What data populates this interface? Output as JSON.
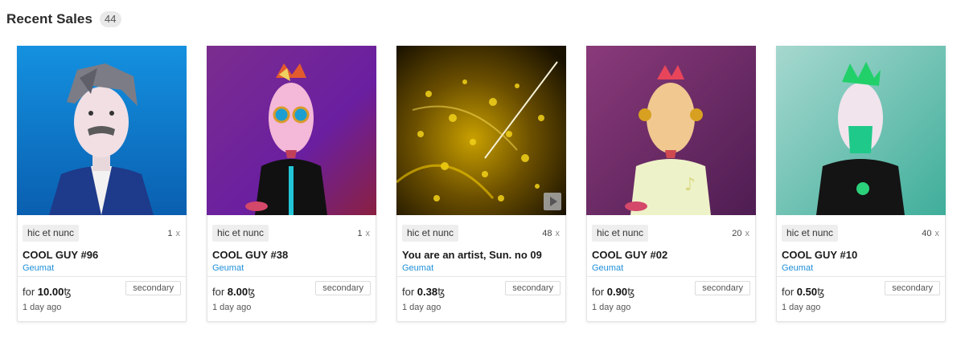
{
  "header": {
    "title": "Recent Sales",
    "count": "44"
  },
  "cards": [
    {
      "platform": "hic et nunc",
      "editions": "1",
      "editions_suffix": "x",
      "title": "COOL GUY #96",
      "creator": "Geumat",
      "sale_type": "secondary",
      "price_prefix": "for",
      "price": "10.00",
      "currency": "ꜩ",
      "time": "1 day ago",
      "has_play": false
    },
    {
      "platform": "hic et nunc",
      "editions": "1",
      "editions_suffix": "x",
      "title": "COOL GUY #38",
      "creator": "Geumat",
      "sale_type": "secondary",
      "price_prefix": "for",
      "price": "8.00",
      "currency": "ꜩ",
      "time": "1 day ago",
      "has_play": false
    },
    {
      "platform": "hic et nunc",
      "editions": "48",
      "editions_suffix": "x",
      "title": "You are an artist, Sun. no 09",
      "creator": "Geumat",
      "sale_type": "secondary",
      "price_prefix": "for",
      "price": "0.38",
      "currency": "ꜩ",
      "time": "1 day ago",
      "has_play": true
    },
    {
      "platform": "hic et nunc",
      "editions": "20",
      "editions_suffix": "x",
      "title": "COOL GUY #02",
      "creator": "Geumat",
      "sale_type": "secondary",
      "price_prefix": "for",
      "price": "0.90",
      "currency": "ꜩ",
      "time": "1 day ago",
      "has_play": false
    },
    {
      "platform": "hic et nunc",
      "editions": "40",
      "editions_suffix": "x",
      "title": "COOL GUY #10",
      "creator": "Geumat",
      "sale_type": "secondary",
      "price_prefix": "for",
      "price": "0.50",
      "currency": "ꜩ",
      "time": "1 day ago",
      "has_play": false
    }
  ],
  "colors": {
    "creator_link": "#1f8fd8",
    "badge_bg": "#e9e9e9",
    "platform_bg": "#eeeeee"
  },
  "icons": {
    "play": "play-icon"
  }
}
